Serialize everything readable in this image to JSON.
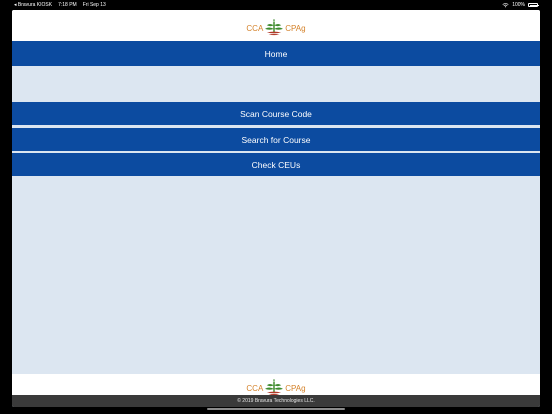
{
  "status_bar": {
    "back_app": "◂ Bravura KIOSK",
    "time": "7:18 PM",
    "date": "Fri Sep 13",
    "battery": "100%"
  },
  "logo": {
    "left_text": "CCA",
    "right_text": "CPAg"
  },
  "header": {
    "title": "Home"
  },
  "menu": {
    "scan_label": "Scan Course Code",
    "search_label": "Search for Course",
    "ceus_label": "Check CEUs"
  },
  "footer": {
    "copyright": "© 2019 Bravura Technologies LLC."
  },
  "colors": {
    "primary_blue": "#0c4ba0",
    "background": "#dce6f1",
    "logo_orange": "#d4822a",
    "logo_green": "#3d8a2c"
  }
}
